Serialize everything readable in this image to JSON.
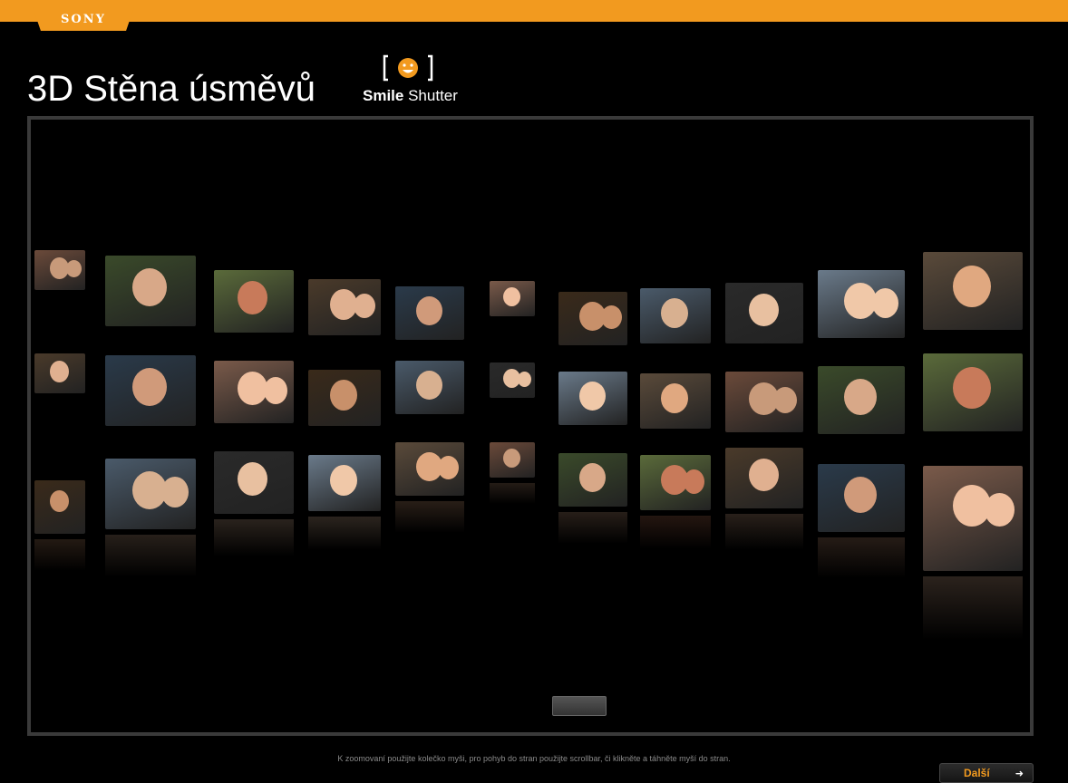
{
  "brand": {
    "logo_text": "SONY",
    "accent_color": "#f29a1f"
  },
  "header": {
    "title": "3D Stěna úsměvů",
    "feature_logo": {
      "word1": "Smile",
      "word2": "Shutter"
    }
  },
  "viewer": {
    "scrollbar": "horizontal-scrollbar",
    "photos_count": 33
  },
  "footer": {
    "hint": "K zoomovaní použijte kolečko myši, pro pohyb do stran použijte scrollbar, či klikněte a táhněte myší do stran.",
    "next_label": "Další",
    "next_icon": "arrow-right-icon"
  }
}
